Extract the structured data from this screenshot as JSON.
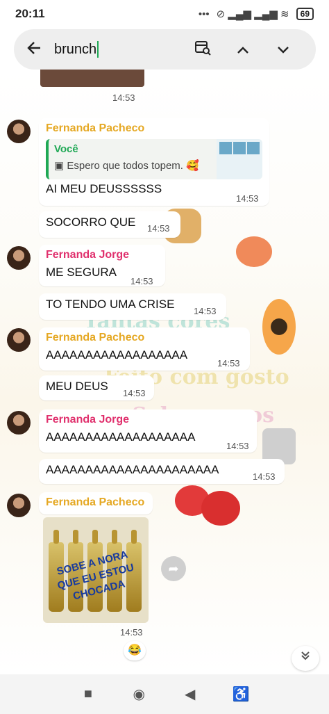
{
  "status_bar": {
    "time": "20:11",
    "dots": "•••",
    "icons": "⊘ ▂▄▆ ▂▄▆ ≋",
    "battery": "69"
  },
  "search": {
    "query": "brunch",
    "back_icon": "arrow-left-icon",
    "calendar_icon": "calendar-search-icon",
    "up_icon": "chevron-up-icon",
    "down_icon": "chevron-down-icon"
  },
  "wallpaper": {
    "line1": "Tantas cores",
    "line2": "Feito com gosto",
    "line3": "Saboreamos"
  },
  "messages": {
    "top_time": "14:53",
    "m1": {
      "sender": "Fernanda Pacheco",
      "sender_color": "#e5a823",
      "quote_name": "Você",
      "quote_text": "Espero que todos topem. 🥰",
      "text": "AI MEU DEUSSSSSS",
      "time": "14:53"
    },
    "m2": {
      "text": "SOCORRO QUE",
      "time": "14:53"
    },
    "m3": {
      "sender": "Fernanda Jorge",
      "sender_color": "#e0306d",
      "text": "ME SEGURA",
      "time": "14:53"
    },
    "m4": {
      "text": "TO TENDO UMA CRISE",
      "time": "14:53"
    },
    "m5": {
      "sender": "Fernanda Pacheco",
      "text": "AAAAAAAAAAAAAAAAAA",
      "time": "14:53"
    },
    "m6": {
      "text": "MEU DEUS",
      "time": "14:53"
    },
    "m7": {
      "sender": "Fernanda Jorge",
      "text": "AAAAAAAAAAAAAAAAAAA",
      "time": "14:53"
    },
    "m8": {
      "text": "AAAAAAAAAAAAAAAAAAAAAA",
      "time": "14:53"
    },
    "m9": {
      "sender": "Fernanda Pacheco",
      "image_caption": "SOBE A NORA QUE EU ESTOU CHOCADA",
      "time": "14:53",
      "reaction": "😂"
    }
  },
  "nav": {
    "square": "■",
    "circle": "◉",
    "back": "◀",
    "accessibility": "♿"
  }
}
